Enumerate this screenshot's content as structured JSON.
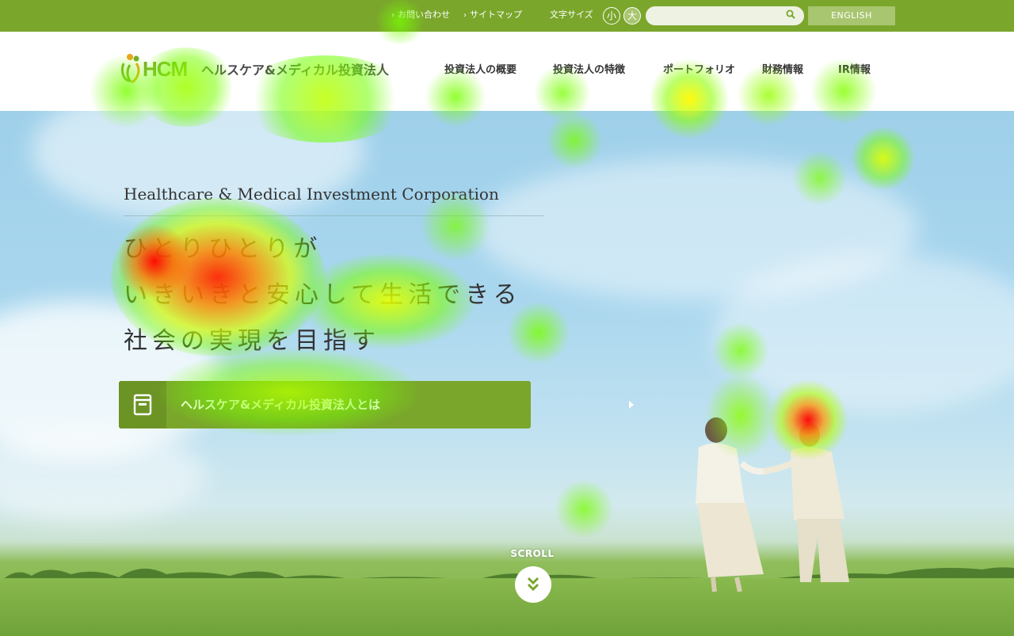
{
  "topbar": {
    "contact_label": "お問い合わせ",
    "sitemap_label": "サイトマップ",
    "font_size_label": "文字サイズ",
    "size_small": "小",
    "size_large": "大",
    "search_placeholder": "",
    "english_label": "ENGLISH"
  },
  "header": {
    "logo_mark": "HCM",
    "logo_text": "ヘルスケア&メディカル投資法人",
    "nav": [
      {
        "label": "投資法人の概要"
      },
      {
        "label": "投資法人の特徴"
      },
      {
        "label": "ポートフォリオ"
      },
      {
        "label": "財務情報"
      },
      {
        "label": "IR情報"
      }
    ]
  },
  "hero": {
    "tagline_en": "Healthcare & Medical Investment Corporation",
    "tagline_jp_lines": [
      "ひとりひとりが",
      "いきいきと安心して生活できる",
      "社会の実現を目指す"
    ],
    "about_button_label": "ヘルスケア&メディカル投資法人とは",
    "scroll_label": "SCROLL"
  },
  "icons": {
    "search": "search-icon",
    "book": "book-icon",
    "arrow": "arrow-right-icon",
    "scroll": "double-chevron-down-icon"
  },
  "colors": {
    "brand_green": "#7aa62c",
    "brand_green_dark": "#6b9425",
    "brand_green_light": "#a8c56f"
  }
}
